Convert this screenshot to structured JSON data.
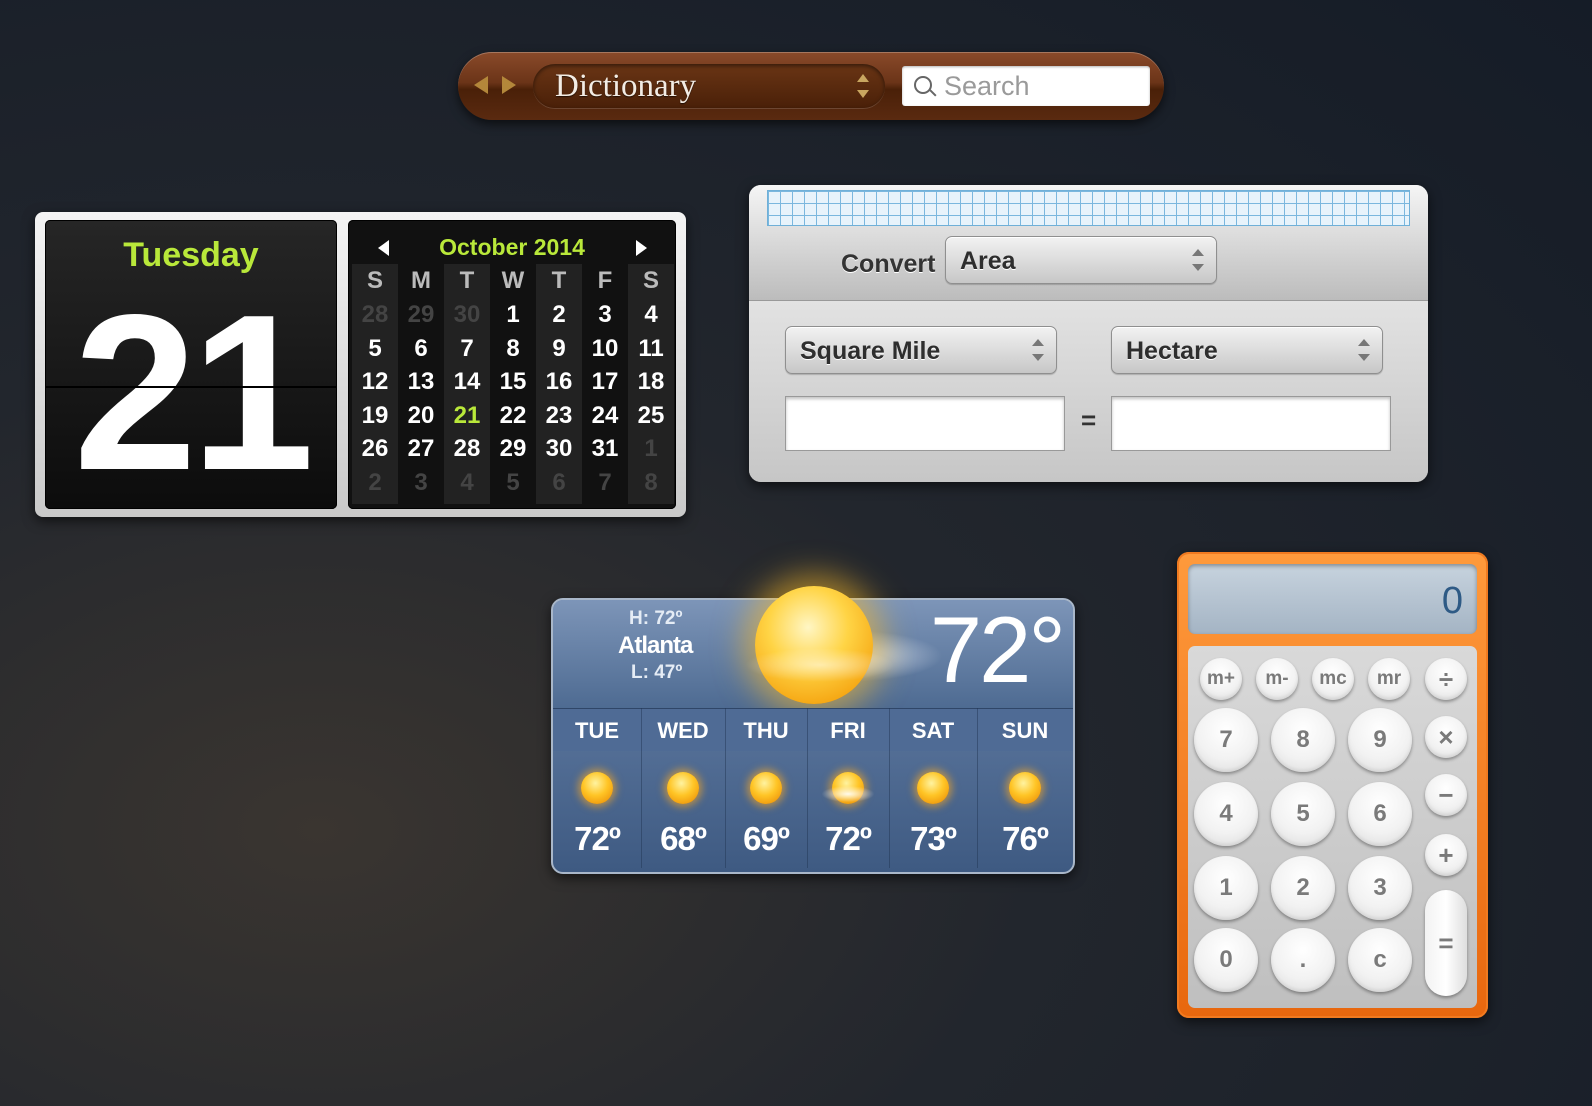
{
  "dictionary": {
    "source_label": "Dictionary",
    "search_placeholder": "Search"
  },
  "calendar": {
    "weekday": "Tuesday",
    "date": "21",
    "month_title": "October 2014",
    "day_headers": [
      "S",
      "M",
      "T",
      "W",
      "T",
      "F",
      "S"
    ],
    "weeks": [
      [
        "28",
        "29",
        "30",
        "1",
        "2",
        "3",
        "4"
      ],
      [
        "5",
        "6",
        "7",
        "8",
        "9",
        "10",
        "11"
      ],
      [
        "12",
        "13",
        "14",
        "15",
        "16",
        "17",
        "18"
      ],
      [
        "19",
        "20",
        "21",
        "22",
        "23",
        "24",
        "25"
      ],
      [
        "26",
        "27",
        "28",
        "29",
        "30",
        "31",
        "1"
      ],
      [
        "2",
        "3",
        "4",
        "5",
        "6",
        "7",
        "8"
      ]
    ],
    "today": "21",
    "colors": {
      "accent": "#b9e83a"
    }
  },
  "converter": {
    "convert_label": "Convert",
    "category": "Area",
    "from_unit": "Square Mile",
    "to_unit": "Hectare",
    "from_value": "",
    "to_value": "",
    "equals": "="
  },
  "weather": {
    "high": "H: 72º",
    "city": "Atlanta",
    "low": "L: 47º",
    "current_temp": "72°",
    "forecast": [
      {
        "day": "TUE",
        "temp": "72º",
        "icon": "sunny-icon"
      },
      {
        "day": "WED",
        "temp": "68º",
        "icon": "sunny-icon"
      },
      {
        "day": "THU",
        "temp": "69º",
        "icon": "sunny-icon"
      },
      {
        "day": "FRI",
        "temp": "72º",
        "icon": "partly-cloudy-icon"
      },
      {
        "day": "SAT",
        "temp": "73º",
        "icon": "sunny-icon"
      },
      {
        "day": "SUN",
        "temp": "76º",
        "icon": "sunny-icon"
      }
    ]
  },
  "calculator": {
    "display": "0",
    "memory": [
      "m+",
      "m-",
      "mc",
      "mr"
    ],
    "divide": "÷",
    "multiply": "×",
    "minus": "−",
    "plus": "+",
    "equals": "=",
    "rows": [
      [
        "7",
        "8",
        "9"
      ],
      [
        "4",
        "5",
        "6"
      ],
      [
        "1",
        "2",
        "3"
      ],
      [
        "0",
        ".",
        "c"
      ]
    ],
    "colors": {
      "body": "#f07a20",
      "display_text": "#2e5a85"
    }
  }
}
